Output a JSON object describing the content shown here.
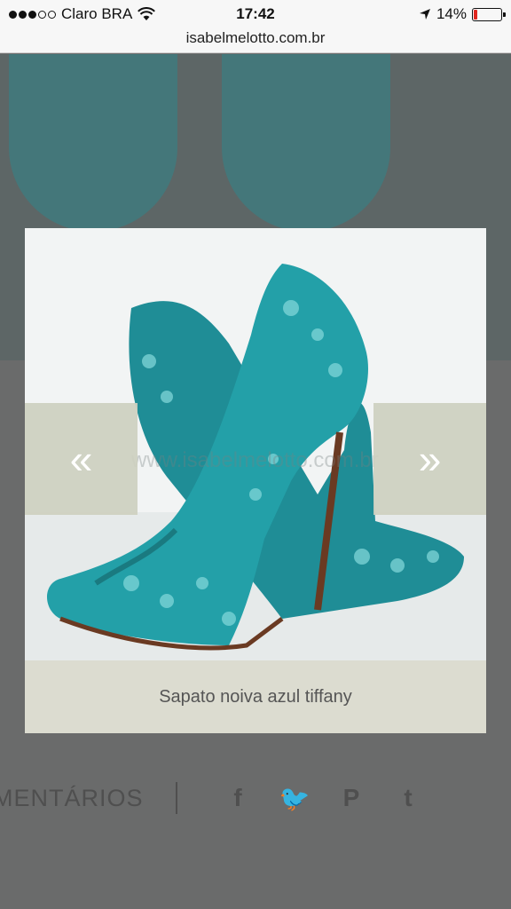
{
  "status_bar": {
    "carrier": "Claro BRA",
    "time": "17:42",
    "battery_percent": "14%",
    "battery_level": 0.14,
    "battery_color": "#e0261f",
    "wifi_icon": "wifi-icon",
    "location_icon": "location-arrow-icon"
  },
  "browser": {
    "url": "isabelmelotto.com.br"
  },
  "background_page": {
    "comments_label": "MENTÁRIOS",
    "social_icons": [
      "facebook-icon",
      "twitter-icon",
      "pinterest-icon",
      "tumblr-icon"
    ],
    "social_glyphs": [
      "f",
      "🐦",
      "P",
      "t"
    ]
  },
  "lightbox": {
    "watermark": "www.isabelmelotto.com.br",
    "prev_glyph": "«",
    "next_glyph": "»",
    "caption": "Sapato noiva azul tiffany",
    "accent_color": "#23a0a8"
  }
}
